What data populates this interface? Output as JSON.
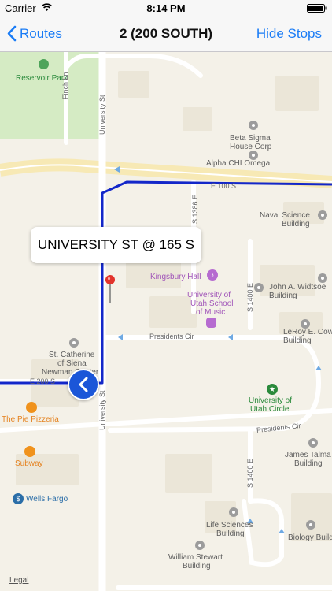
{
  "status_bar": {
    "carrier": "Carrier",
    "time": "8:14 PM"
  },
  "nav": {
    "back_label": "Routes",
    "title": "2 (200 SOUTH)",
    "right_button": "Hide Stops"
  },
  "map": {
    "callout": "UNIVERSITY ST @ 165 S",
    "legal": "Legal",
    "labels": {
      "reservoir_park": "Reservoir Park",
      "finch_ln": "Finch Ln",
      "university_st_top": "University St",
      "university_st_callout": "Univ ty St",
      "university_st_bottom": "University St",
      "beta_sigma_line1": "Beta Sigma",
      "beta_sigma_line2": "House Corp",
      "alpha_chi": "Alpha CHI Omega",
      "e100s": "E 100 S",
      "s1386e": "S 1386 E",
      "naval_line1": "Naval Science",
      "naval_line2": "Building",
      "kingsbury": "Kingsbury Hall",
      "uofu_music_line1": "University of",
      "uofu_music_line2": "Utah School",
      "uofu_music_line3": "of Music",
      "s1400e_top": "S 1400 E",
      "widtsoe_line1": "John A. Widtsoe",
      "widtsoe_line2": "Building",
      "leroy_line1": "LeRoy E. Cow",
      "leroy_line2": "Building",
      "presidents_cir_top": "Presidents Cir",
      "st_catherine_line1": "St. Catherine",
      "st_catherine_line2": "of Siena",
      "st_catherine_line3": "Newman Center",
      "e200s": "E 200 S",
      "pie_pizzeria": "The Pie Pizzeria",
      "university_circle_line1": "University of",
      "university_circle_line2": "Utah Circle",
      "presidents_cir_bottom": "Presidents Cir",
      "subway": "Subway",
      "wells_fargo": "Wells Fargo",
      "james_talma_line1": "James Talma",
      "james_talma_line2": "Building",
      "s1400e_bottom": "S 1400 E",
      "life_sciences_line1": "Life Sciences",
      "life_sciences_line2": "Building",
      "biology_building": "Biology Build",
      "william_stewart_line1": "William Stewart",
      "william_stewart_line2": "Building"
    }
  },
  "colors": {
    "route": "#1327c9",
    "accent": "#1a7cf6",
    "park": "#d5ebc4",
    "road": "#ffffff",
    "major_road": "#f7e9b5"
  }
}
